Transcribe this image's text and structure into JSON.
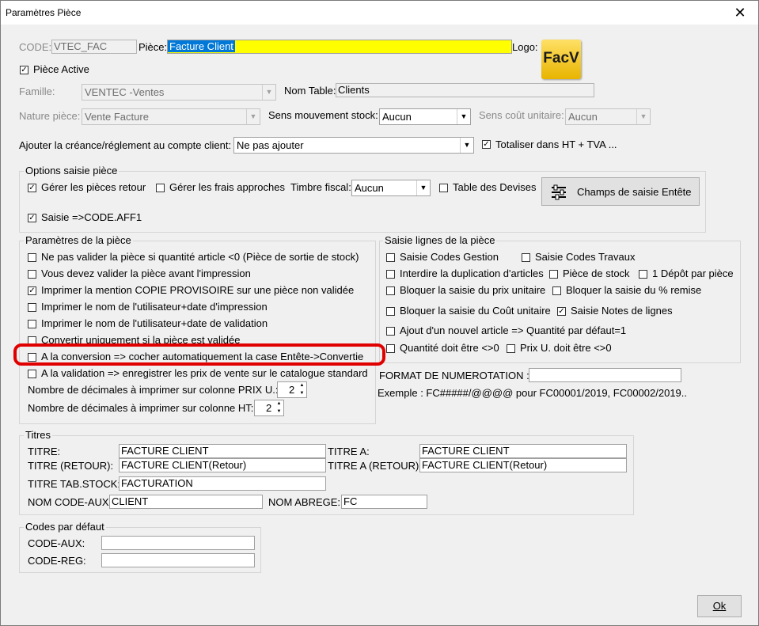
{
  "window": {
    "title": "Paramètres Pièce",
    "close_glyph": "✕"
  },
  "header": {
    "code_label": "CODE:",
    "code_value": "VTEC_FAC",
    "piece_label": "Pièce:",
    "piece_value": "Facture Client",
    "logo_label": "Logo:",
    "logo_text": "FacV",
    "piece_active_label": "Pièce Active",
    "piece_active_checked": true,
    "famille_label": "Famille:",
    "famille_value": "VENTEC    -Ventes",
    "nom_table_label": "Nom Table:",
    "nom_table_value": "Clients",
    "nature_label": "Nature pièce:",
    "nature_value": "Vente Facture",
    "sens_stock_label": "Sens mouvement stock:",
    "sens_stock_value": "Aucun",
    "sens_cout_label": "Sens coût unitaire:",
    "sens_cout_value": "Aucun",
    "ajouter_label": "Ajouter la créance/réglement au compte client:",
    "ajouter_value": "Ne pas ajouter",
    "totaliser_label": "Totaliser dans HT + TVA ...",
    "totaliser_checked": true
  },
  "options": {
    "group_label": "Options saisie pièce",
    "gerer_retour": "Gérer les pièces retour",
    "gerer_frais": "Gérer les frais approches",
    "timbre_label": "Timbre fiscal:",
    "timbre_value": "Aucun",
    "table_devises": "Table des Devises",
    "champs_button": "Champs de saisie Entête",
    "saisie_aff": "Saisie =>CODE.AFF1"
  },
  "parametres": {
    "group_label": "Paramètres de la pièce",
    "items": [
      "Ne pas valider la pièce si quantité article <0 (Pièce de sortie de stock)",
      "Vous devez valider la pièce avant l'impression",
      "Imprimer la mention COPIE PROVISOIRE sur une pièce non validée",
      "Imprimer le nom de l'utilisateur+date d'impression",
      "Imprimer le nom de l'utilisateur+date de validation",
      "Convertir uniquement si la pièce est validée",
      "A la conversion => cocher automatiquement la case Entête->Convertie",
      "A la validation => enregistrer les prix de vente sur le catalogue standard"
    ],
    "dec_prix_label": "Nombre de décimales à imprimer sur colonne PRIX U.:",
    "dec_prix_value": "2",
    "dec_ht_label": "Nombre de décimales à imprimer sur colonne HT:",
    "dec_ht_value": "2"
  },
  "saisie_lignes": {
    "group_label": "Saisie lignes de la pièce",
    "codes_gestion": "Saisie Codes Gestion",
    "codes_travaux": "Saisie Codes Travaux",
    "interdire_dup": "Interdire la duplication d'articles",
    "piece_stock": "Pièce de stock",
    "un_depot": "1 Dépôt par pièce",
    "bloquer_prix": "Bloquer la saisie du prix unitaire",
    "bloquer_remise": "Bloquer la saisie du % remise",
    "bloquer_cout": "Bloquer la saisie du Coût unitaire",
    "notes_lignes": "Saisie Notes de lignes",
    "ajout_article": "Ajout d'un nouvel article => Quantité par défaut=1",
    "quantite_nonzero": "Quantité doit être <>0",
    "prix_nonzero": "Prix U. doit être <>0"
  },
  "numerotation": {
    "label": "FORMAT DE NUMEROTATION :",
    "value": "",
    "example": "Exemple : FC#####/@@@@ pour FC00001/2019, FC00002/2019.."
  },
  "titres": {
    "group_label": "Titres",
    "titre_label": "TITRE:",
    "titre_value": "FACTURE CLIENT",
    "titre_a_label": "TITRE A:",
    "titre_a_value": "FACTURE CLIENT",
    "titre_retour_label": "TITRE (RETOUR):",
    "titre_retour_value": "FACTURE CLIENT(Retour)",
    "titre_a_retour_label": "TITRE A (RETOUR):",
    "titre_a_retour_value": "FACTURE CLIENT(Retour)",
    "tab_stock_label": "TITRE TAB.STOCK:",
    "tab_stock_value": "FACTURATION",
    "nom_code_aux_label": "NOM CODE-AUX:",
    "nom_code_aux_value": "CLIENT",
    "nom_abrege_label": "NOM ABREGE:",
    "nom_abrege_value": "FC"
  },
  "codes_defaut": {
    "group_label": "Codes par défaut",
    "code_aux_label": "CODE-AUX:",
    "code_aux_value": "",
    "code_reg_label": "CODE-REG:",
    "code_reg_value": ""
  },
  "footer": {
    "ok_label": "Ok"
  },
  "colors": {
    "piece_field": "#ffff00",
    "selection": "#0078d7",
    "highlight": "#e00000",
    "logo": "#f0c000"
  }
}
